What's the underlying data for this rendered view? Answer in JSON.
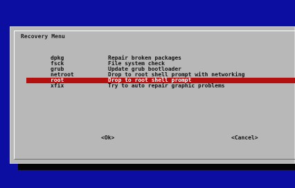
{
  "dialog": {
    "title": "Recovery Menu",
    "menu_items": [
      {
        "key": "dpkg",
        "description": "Repair broken packages"
      },
      {
        "key": "fsck",
        "description": "File system check"
      },
      {
        "key": "grub",
        "description": "Update grub bootloader"
      },
      {
        "key": "netroot",
        "description": "Drop to root shell prompt with networking"
      },
      {
        "key": "root",
        "description": "Drop to root shell prompt",
        "selected": true
      },
      {
        "key": "xfix",
        "description": "Try to auto repair graphic problems"
      }
    ],
    "ok_label": "<Ok>",
    "cancel_label": "<Cancel>"
  },
  "colors": {
    "background": "#0c0ea2",
    "dialog": "#b8b8b8",
    "selection": "#b41010",
    "shadow": "#050505"
  }
}
